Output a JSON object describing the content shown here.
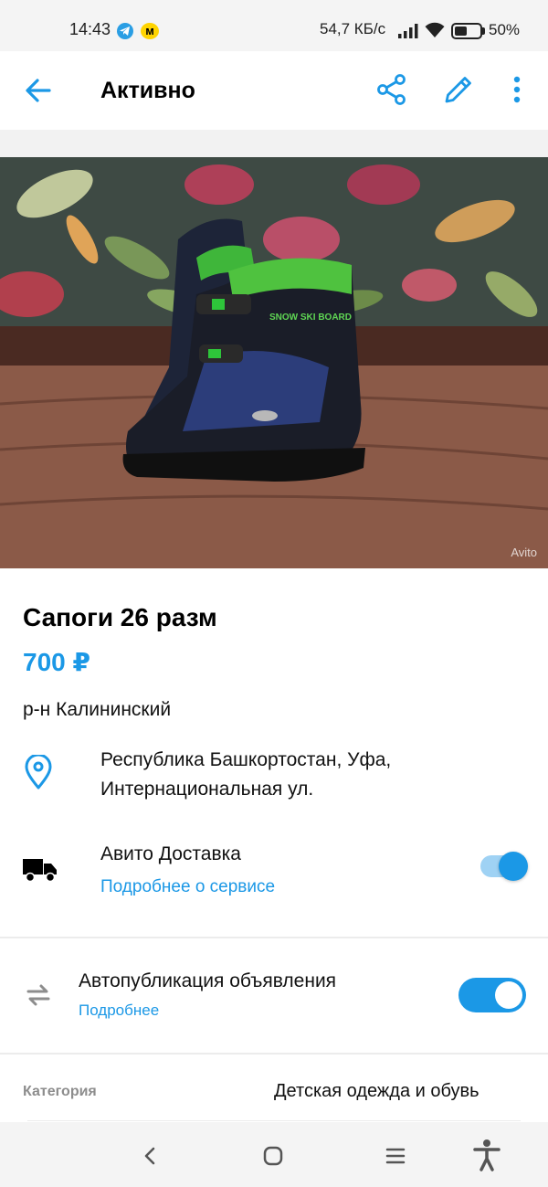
{
  "status_bar": {
    "time": "14:43",
    "speed": "54,7 КБ/с",
    "battery": "50%",
    "battery_level": 0.5,
    "ymusic_glyph": "м",
    "icons": [
      "telegram-icon",
      "yandex-music-icon",
      "signal-icon",
      "wifi-icon",
      "battery-icon"
    ]
  },
  "toolbar": {
    "title": "Активно",
    "icons": [
      "back-arrow-icon",
      "share-icon",
      "edit-pencil-icon",
      "more-vert-icon"
    ]
  },
  "photo": {
    "watermark": "Avito",
    "subject_text": "SNOW SKI BOARD"
  },
  "listing": {
    "title": "Сапоги 26 разм",
    "price": "700 ₽",
    "district": "р-н Калининский",
    "address_line1": "Республика Башкортостан, Уфа,",
    "address_line2": "Интернациональная ул."
  },
  "delivery": {
    "label": "Авито Доставка",
    "link": "Подробнее о сервисе",
    "enabled": true
  },
  "autopublish": {
    "label": "Автопубликация объявления",
    "link": "Подробнее",
    "enabled": true
  },
  "params": {
    "category_label": "Категория",
    "category_value": "Детская одежда и обувь"
  },
  "colors": {
    "accent": "#1b98e6",
    "text": "#111111",
    "muted": "#8d8d8d"
  },
  "nav": {
    "icons": [
      "nav-back-icon",
      "nav-home-icon",
      "nav-recents-icon",
      "accessibility-icon"
    ]
  }
}
